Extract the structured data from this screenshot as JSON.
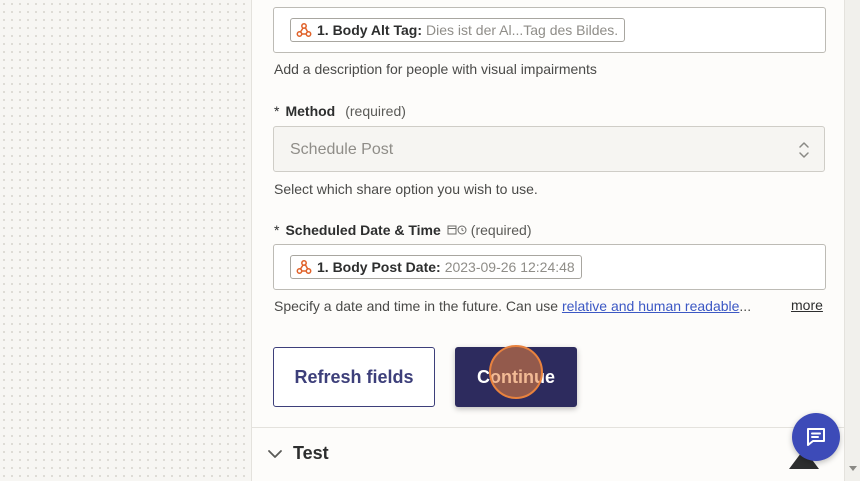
{
  "alt_tag_field": {
    "pill_label": "1. Body Alt Tag:",
    "pill_value": "Dies ist der Al...Tag des Bildes.",
    "help": "Add a description for people with visual impairments"
  },
  "method_field": {
    "star": "*",
    "label": "Method",
    "required": "(required)",
    "value": "Schedule Post",
    "help": "Select which share option you wish to use."
  },
  "date_field": {
    "star": "*",
    "label": "Scheduled Date & Time",
    "required": "(required)",
    "pill_label": "1. Body Post Date:",
    "pill_value": "2023-09-26 12:24:48",
    "help_prefix": "Specify a date and time in the future. Can use ",
    "help_link": "relative and human readable",
    "help_ellipsis": "...",
    "more": "more"
  },
  "buttons": {
    "refresh": "Refresh fields",
    "continue": "Continue"
  },
  "test_section": {
    "label": "Test"
  },
  "colors": {
    "primary": "#2d2b5e",
    "accent": "#e8823e",
    "chat": "#3d4bb8"
  },
  "icons": [
    "webhook-icon",
    "chevron-updown-icon",
    "calendar-clock-icon",
    "chevron-down-icon",
    "chat-icon",
    "warning-icon"
  ]
}
